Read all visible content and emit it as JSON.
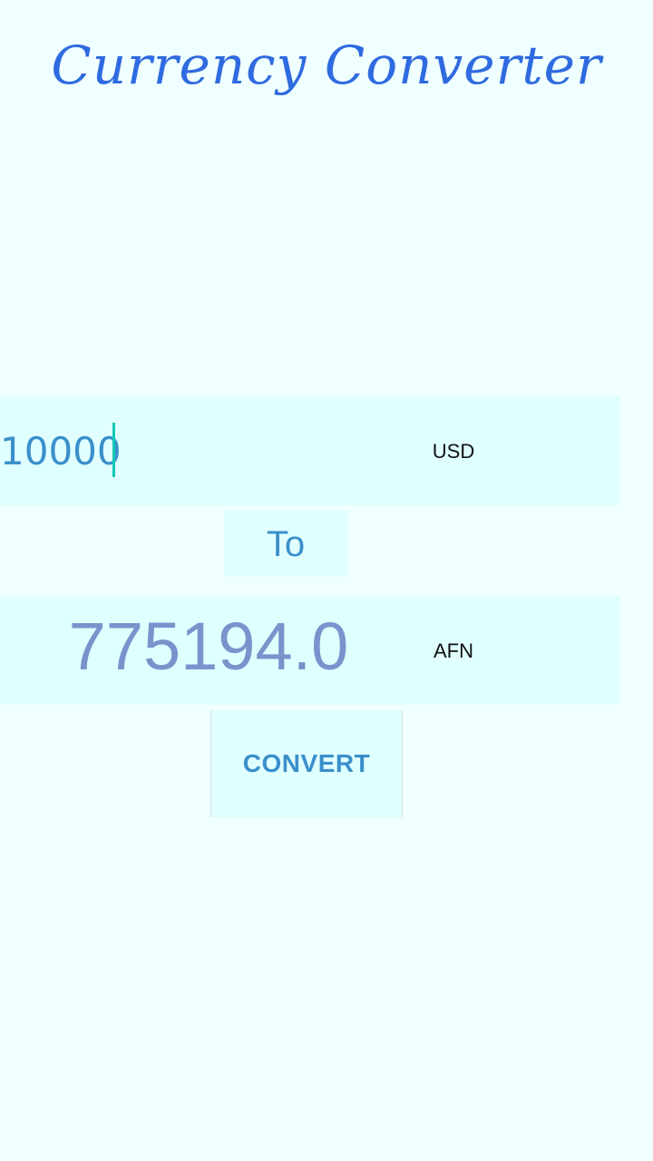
{
  "app": {
    "title": "Currency Converter"
  },
  "from": {
    "amount": "10000",
    "currency": "USD"
  },
  "separator": {
    "label": "To"
  },
  "to": {
    "amount": "775194.0",
    "currency": "AFN"
  },
  "actions": {
    "convert_label": "CONVERT"
  },
  "colors": {
    "background": "#F0FFFF",
    "panel": "#E0FFFF",
    "title": "#2F6BE0",
    "accent": "#3A8FCB",
    "result": "#7B93CC",
    "cursor": "#14C8B5"
  }
}
